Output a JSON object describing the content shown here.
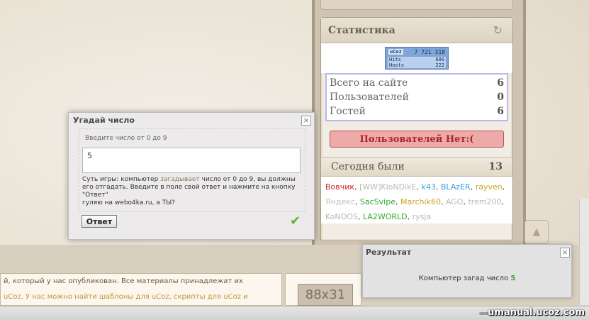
{
  "stats": {
    "title": "Статистика",
    "refresh_icon": "refresh-icon",
    "counter": {
      "brand": "uCoz",
      "total": "7 721 318",
      "hits_label": "Hits",
      "hits": "606",
      "hosts_label": "Hosts",
      "hosts": "222"
    },
    "online": [
      {
        "label": "Всего на сайте",
        "value": "6"
      },
      {
        "label": "Пользователей",
        "value": "0"
      },
      {
        "label": "Гостей",
        "value": "6"
      }
    ],
    "no_users": "Пользователей Нет:(",
    "today_label": "Сегодня были",
    "today_count": "13",
    "visitors": [
      {
        "name": "Вовчик",
        "color": "#d42020"
      },
      {
        "name": "[WW]KloNDikE",
        "color": "#b8b8b8"
      },
      {
        "name": "k43",
        "color": "#3b9be0"
      },
      {
        "name": "BLAzER",
        "color": "#3b9be0"
      },
      {
        "name": "rayven",
        "color": "#c9a326"
      },
      {
        "name": "Яндекс",
        "color": "#c0c0c0"
      },
      {
        "name": "SacSvipe",
        "color": "#2faa2f"
      },
      {
        "name": "Marchik60",
        "color": "#c9a326"
      },
      {
        "name": "AGO",
        "color": "#b8b8b8"
      },
      {
        "name": "trem200",
        "color": "#b8b8b8"
      },
      {
        "name": "KoNOOS",
        "color": "#b8b8b8"
      },
      {
        "name": "LA2WORLD",
        "color": "#2faa2f"
      },
      {
        "name": "rysja",
        "color": "#b8b8b8"
      }
    ]
  },
  "guess": {
    "title": "Угадай число",
    "prompt": "Введите число от 0 до 9",
    "input_value": "5",
    "rules_1": "Суть игры: компьютер ",
    "rules_hl": "загадывает",
    "rules_2": " число от 0 до 9, вы должны его отгадать. Введите в поле свой ответ и нажмите на кнопку \"Ответ\"",
    "rules_3": "гуляю на webo4ka.ru, а ТЫ?",
    "answer_label": "Ответ",
    "close": "×",
    "check": "✔"
  },
  "result": {
    "title": "Результат",
    "message": "Компьютер загад число ",
    "number": "5",
    "close": "×"
  },
  "content": {
    "line1": "й, который у нас опубликован. Все материалы принадлежат их",
    "line2": "uCoz. У нас можно найти шаблоны для uCoz, скрипты для uCoz и",
    "badge": "88x31"
  },
  "watermark": "umanual.ucoz.com",
  "scroll_up": "▲"
}
